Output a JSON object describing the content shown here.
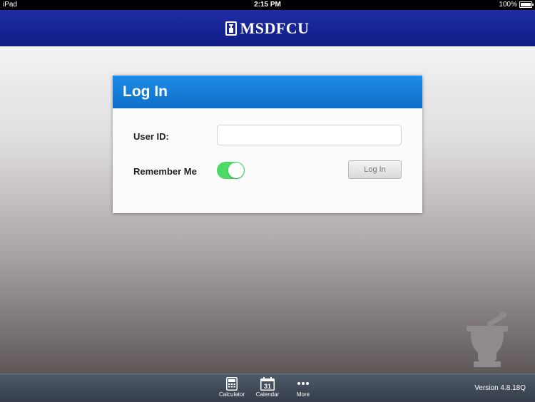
{
  "status_bar": {
    "carrier": "iPad",
    "time": "2:15 PM",
    "battery": "100%"
  },
  "header": {
    "logo_text": "MSDFCU"
  },
  "login": {
    "title": "Log In",
    "userid_label": "User ID:",
    "userid_value": "",
    "remember_label": "Remember Me",
    "remember_me_on": true,
    "button_label": "Log In"
  },
  "tab_bar": {
    "items": [
      {
        "label": "Calculator",
        "icon": "calculator-icon"
      },
      {
        "label": "Calendar",
        "icon": "calendar-icon",
        "icon_text": "31"
      },
      {
        "label": "More",
        "icon": "more-icon"
      }
    ],
    "version": "Version 4.8.18Q"
  },
  "colors": {
    "header_blue": "#1a279a",
    "card_header_blue": "#1580dc",
    "toggle_green": "#4cd964"
  }
}
